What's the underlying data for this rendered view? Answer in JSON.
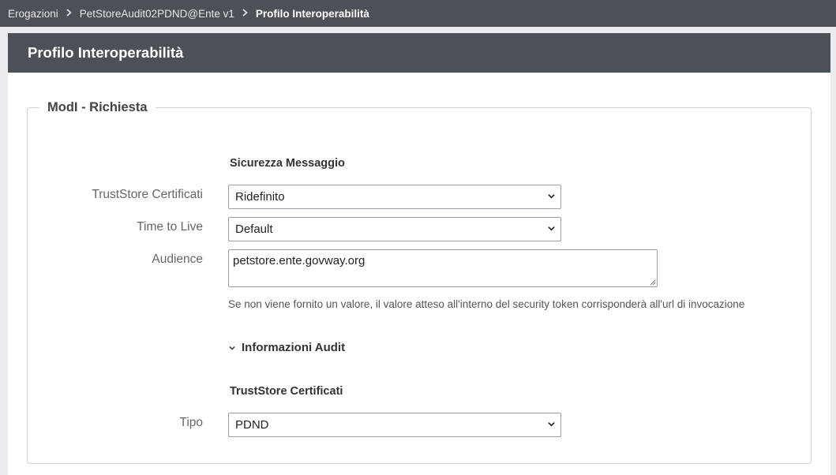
{
  "breadcrumb": {
    "items": [
      "Erogazioni",
      "PetStoreAudit02PDND@Ente v1",
      "Profilo Interoperabilità"
    ],
    "separator_icon": "chevron-right-icon"
  },
  "panel": {
    "title": "Profilo Interoperabilità"
  },
  "fieldset": {
    "legend": "ModI - Richiesta",
    "sicurezza": {
      "title": "Sicurezza Messaggio",
      "truststore_label": "TrustStore Certificati",
      "truststore_value": "Ridefinito",
      "ttl_label": "Time to Live",
      "ttl_value": "Default",
      "audience_label": "Audience",
      "audience_value": "petstore.ente.govway.org",
      "audience_hint": "Se non viene fornito un valore, il valore atteso all'interno del security token corrisponderà all'url di invocazione"
    },
    "audit": {
      "toggle_label": "Informazioni Audit",
      "toggle_icon": "chevron-down-icon"
    },
    "truststore_section": {
      "title": "TrustStore Certificati",
      "tipo_label": "Tipo",
      "tipo_value": "PDND"
    }
  },
  "colors": {
    "header_bg": "#4c5158",
    "page_bg": "#eaebef"
  }
}
